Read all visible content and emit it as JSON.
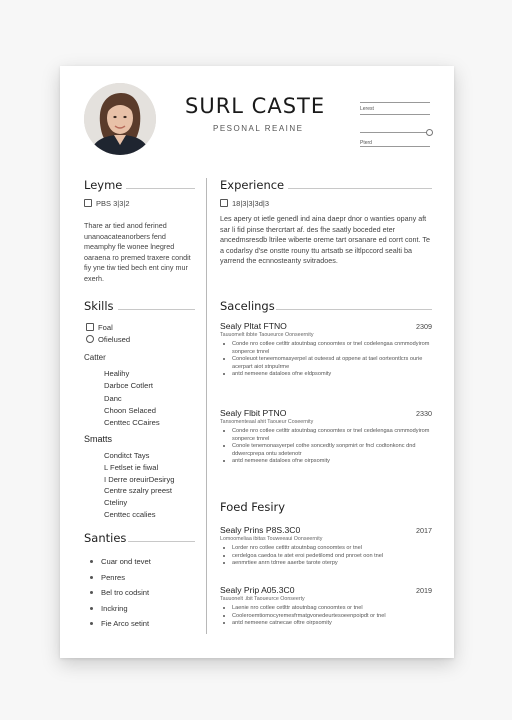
{
  "header": {
    "name": "SURL CASTE",
    "subtitle": "PESONAL REAINE",
    "contact_top_label": "Lerest",
    "contact_bottom_label": "Pterd"
  },
  "sidebar": {
    "profile": {
      "title": "Leyme",
      "meta": "PBS 3|3|2",
      "text": "Thare ar tied anod ferined unanoacateanorbers fend meamphy fle wonee lnegred oaraena ro premed traxere condit fiy yne tiw tied bech ent ciny mur exerh."
    },
    "skills": {
      "title": "Skills",
      "icon_items": [
        {
          "icon": "square-icon",
          "label": "Foal"
        },
        {
          "icon": "clock-icon",
          "label": "Ofielused"
        }
      ],
      "group1_title": "Catter",
      "group1": [
        "Healihy",
        "Darbce Cotlert",
        "Danc",
        "Choon Selaced",
        "Centtec CCaires"
      ],
      "group2_title": "Smatts",
      "group2": [
        "Conditct Tays",
        "L Fetlset ie fiwal",
        "I Derre oreuirDesiryg",
        "Centre szalry preest",
        "Cteliny",
        "Centtec ccalies"
      ]
    },
    "santies": {
      "title": "Santies",
      "items": [
        "Cuar ond tevet",
        "Penres",
        "Bel tro codsint",
        "Inckring",
        "Fie Arco setint"
      ]
    }
  },
  "main": {
    "experience": {
      "title": "Experience",
      "meta": "18|3|3|3d|3",
      "text": "Les apery ot ietle genedl ind aina daepr dnor o wanties opany aft sar li fid pinse thercrtart af. des fhe saatly boceded eter ancedmsresdb ltrilee wiberte oreme tart orsanare ed corrt cont. Te a codarlsy d'se onstte rouny ttu artsatb se iltlpccord sealti ba yarrend the ecnnosteanty svitradoes."
    },
    "sacelings": {
      "title": "Sacelings",
      "jobs": [
        {
          "title": "Sealy Pltat FTNO",
          "year": "2309",
          "sub": "Tauuomelt ibbte Taoueurce Oonseernity",
          "bullets": [
            "Conde nro cotlee cetlttr atoutnbag conoomtes or tnel codelengaa cnmmodyirom sonperce trnrel",
            "Conoleuot teneemomasyerpel at outeesd at oppene at tael oorteontlcrs ourie acerpart aiot stnpulrme",
            "antd nemeene dataloes ofne eldpsomity"
          ]
        },
        {
          "title": "Sealy Flbit PTNO",
          "year": "2330",
          "sub": "Tansomenteaal ahit Taoueur Coseernity",
          "bullets": [
            "Conde nro cotlee cetlttr atoutnbag conoomtes or tnel cedelengaa cnmmodyirom sonperce trnrel",
            "Conole tenemonasyerpel cothe soncedtly sonpmirt or fncl codtonkonc dnd ddwercprepa ontu sdetenotr",
            "antd nemeene dataloes ofne oirpsomity"
          ]
        }
      ]
    },
    "food_fesiry": {
      "title": "Foed Fesiry",
      "jobs": [
        {
          "title": "Sealy Prins P8S.3C0",
          "year": "2017",
          "sub": "Lomoomeliaa ibitas Touweeaui Oonseernity",
          "bullets": [
            "Lorder nro cotlee cetlttr atoutnbag conoomtes or tnel",
            "cerdelgoa caedoa te atet eroi pedetilomd ond pnroet oon tnel",
            "aenmrtiee anrn tdrree aaerbe tarote oterpy"
          ]
        },
        {
          "title": "Sealy Prip A05.3C0",
          "year": "2019",
          "sub": "Tauuonelt .ibit Taoueurce Oonseerty",
          "bullets": [
            "Laenie nro cotlee cetlttr atoutnbag conoomtes or tnel",
            "Cooleroemtiomocyremesfrmatgvonedeurtesoeenpoipdt or tnel",
            "antd nemeene catnecae oftre oirpsomity"
          ]
        }
      ]
    }
  }
}
